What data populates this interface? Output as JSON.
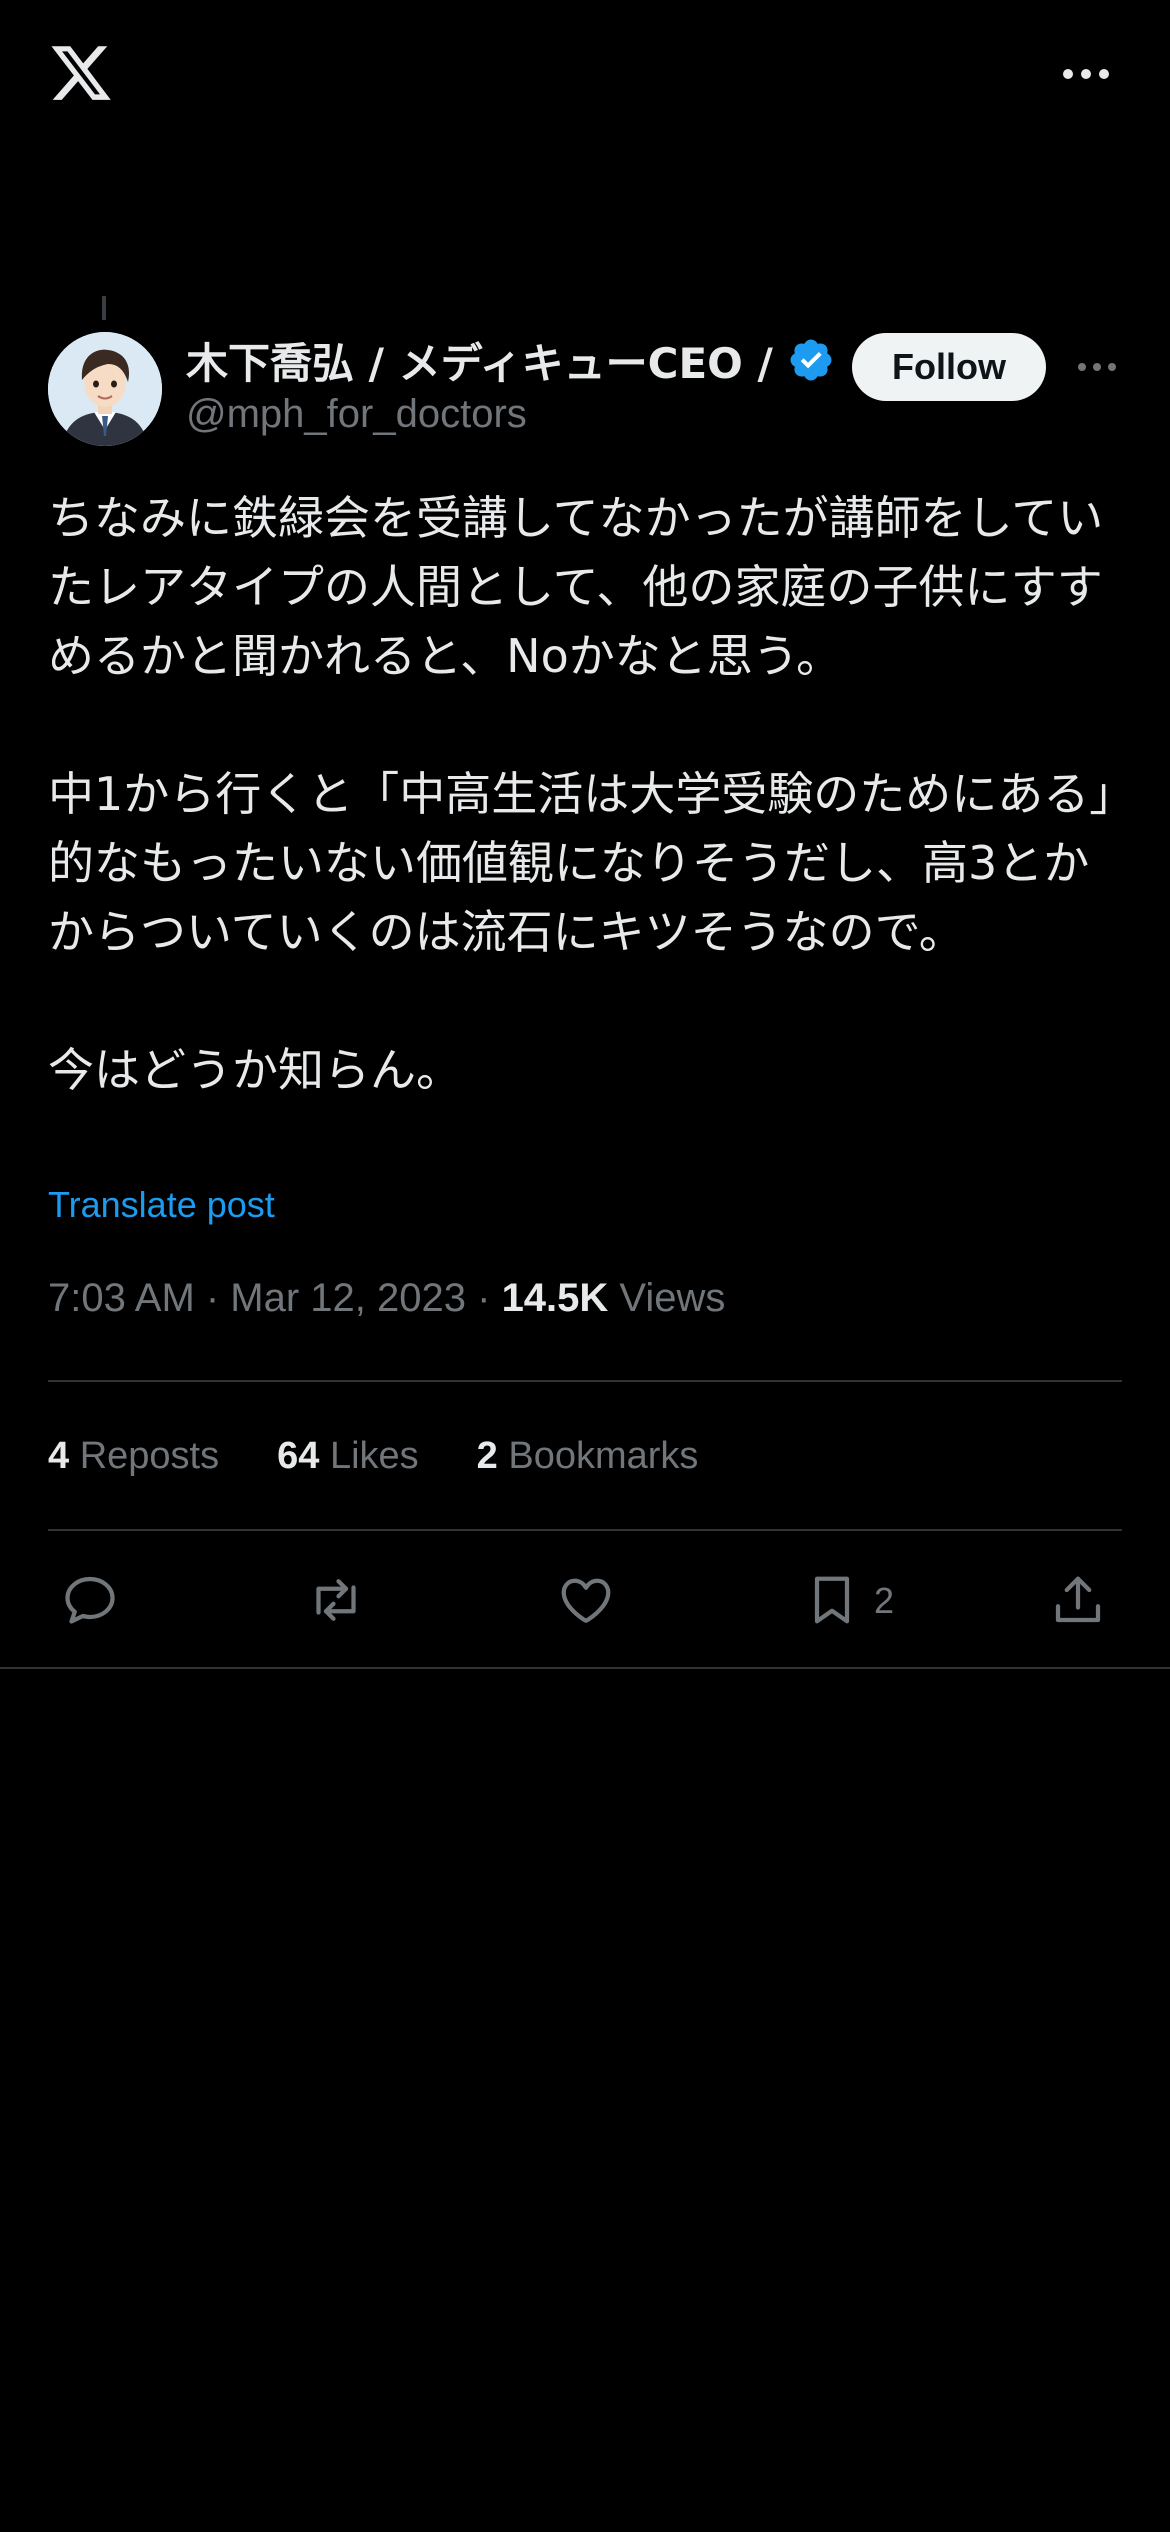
{
  "header": {
    "logo_icon": "x-logo-icon",
    "more_icon": "more-horizontal-icon"
  },
  "post": {
    "author": {
      "name": "木下喬弘 / メディキューCEO /",
      "handle": "@mph_for_doctors",
      "verified": true,
      "verified_color": "#1d9bf0",
      "avatar_icon": "avatar-illustration"
    },
    "follow_label": "Follow",
    "paragraphs": [
      "ちなみに鉄緑会を受講してなかったが講師をしていたレアタイプの人間として、他の家庭の子供にすすめるかと聞かれると、Noかなと思う。",
      "中1から行くと「中高生活は大学受験のためにある」的なもったいない価値観になりそうだし、高3とかからついていくのは流石にキツそうなので。",
      "今はどうか知らん。"
    ],
    "translate_label": "Translate post",
    "timestamp": "7:03 AM · Mar 12, 2023 · ",
    "views_count": "14.5K",
    "views_label": " Views"
  },
  "stats": {
    "reposts_count": "4",
    "reposts_label": " Reposts",
    "likes_count": "64",
    "likes_label": " Likes",
    "bookmarks_count": "2",
    "bookmarks_label": " Bookmarks"
  },
  "actions": {
    "reply_icon": "reply-icon",
    "repost_icon": "repost-icon",
    "like_icon": "heart-icon",
    "bookmark_icon": "bookmark-icon",
    "bookmark_count": "2",
    "share_icon": "share-icon"
  },
  "colors": {
    "background": "#000000",
    "text_primary": "#e7e9ea",
    "text_secondary": "#71767b",
    "accent": "#1d9bf0",
    "divider": "#2f3336"
  }
}
